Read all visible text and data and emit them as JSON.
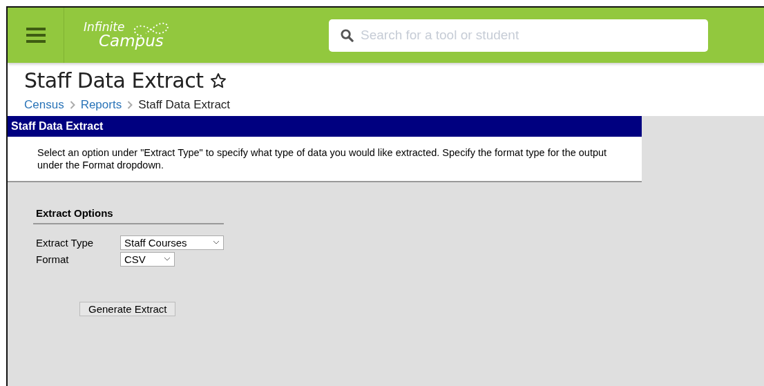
{
  "header": {
    "logo": {
      "line_1": "Infinite",
      "line_2": "Campus"
    },
    "search": {
      "placeholder": "Search for a tool or student"
    }
  },
  "page": {
    "title": "Staff Data Extract",
    "favorite": false,
    "breadcrumbs": [
      {
        "label": "Census",
        "link": true
      },
      {
        "label": "Reports",
        "link": true
      },
      {
        "label": "Staff Data Extract",
        "link": false
      }
    ]
  },
  "panel": {
    "title": "Staff Data Extract",
    "description": "Select an option under \"Extract Type\" to specify what type of data you would like extracted. Specify the format type for the output under the Format dropdown."
  },
  "extract_options": {
    "title": "Extract Options",
    "fields": [
      {
        "label": "Extract Type",
        "value": "Staff Courses",
        "kind": "wide"
      },
      {
        "label": "Format",
        "value": "CSV",
        "kind": "narrow"
      }
    ],
    "button": "Generate Extract"
  }
}
